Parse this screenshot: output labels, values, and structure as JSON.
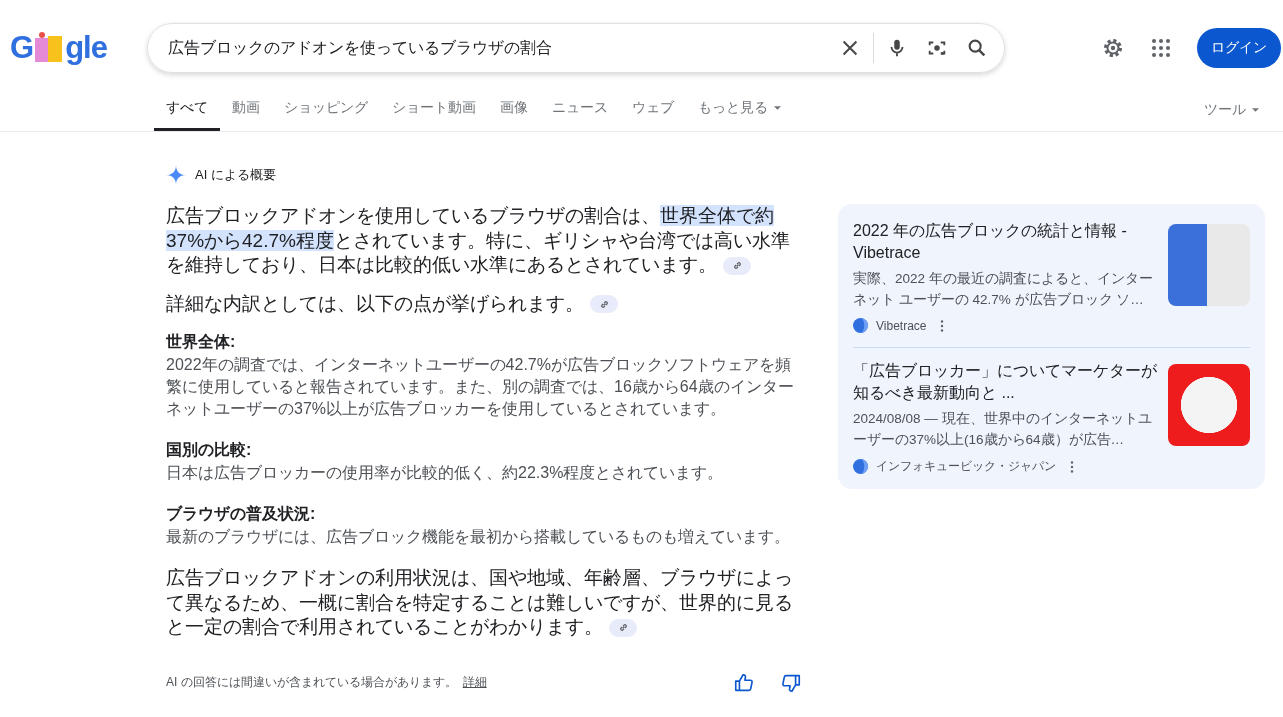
{
  "logo": {
    "left": "G",
    "right": "gle"
  },
  "search": {
    "value": "広告ブロックのアドオンを使っているブラウザの割合"
  },
  "header": {
    "login_button": "ログイン"
  },
  "tabs": [
    {
      "label": "すべて",
      "selected": true,
      "dropdown": false
    },
    {
      "label": "動画",
      "selected": false,
      "dropdown": false
    },
    {
      "label": "ショッピング",
      "selected": false,
      "dropdown": false
    },
    {
      "label": "ショート動画",
      "selected": false,
      "dropdown": false
    },
    {
      "label": "画像",
      "selected": false,
      "dropdown": false
    },
    {
      "label": "ニュース",
      "selected": false,
      "dropdown": false
    },
    {
      "label": "ウェブ",
      "selected": false,
      "dropdown": false
    },
    {
      "label": "もっと見る",
      "selected": false,
      "dropdown": true
    }
  ],
  "tools": "ツール",
  "overview": {
    "label": "AI による概要",
    "blocks": [
      {
        "kind": "paragraph",
        "source_link": true,
        "parts": [
          {
            "text": "広告ブロックアドオンを使用しているブラウザの割合は、",
            "highlighted": false
          },
          {
            "text": "世界全体で約37%から42.7%程度",
            "highlighted": true
          },
          {
            "text": "とされています。特に、ギリシャや台湾では高い水準を維持しており、日本は比較的低い水準にあるとされています。",
            "highlighted": false
          }
        ]
      },
      {
        "kind": "paragraph",
        "source_link": true,
        "parts": [
          {
            "text": "詳細な内訳としては、以下の点が挙げられます。",
            "highlighted": false
          }
        ]
      },
      {
        "kind": "section",
        "heading": "世界全体:",
        "body": "2022年の調査では、インターネットユーザーの42.7%が広告ブロックソフトウェアを頻繁に使用していると報告されています。また、別の調査では、16歳から64歳のインターネットユーザーの37%以上が広告ブロッカーを使用しているとされています。"
      },
      {
        "kind": "section",
        "heading": "国別の比較:",
        "body": "日本は広告ブロッカーの使用率が比較的低く、約22.3%程度とされています。"
      },
      {
        "kind": "section",
        "heading": "ブラウザの普及状況:",
        "body": "最新のブラウザには、広告ブロック機能を最初から搭載しているものも増えています。"
      },
      {
        "kind": "paragraph",
        "source_link": true,
        "parts": [
          {
            "text": "広告ブロックアドオンの利用状況は、国や地域、年齢層、ブラウザによって異なるため、一概に割合を特定することは難しいですが、世界的に見ると一定の割合で利用されていることがわかります。",
            "highlighted": false
          }
        ]
      }
    ],
    "disclaimer": "AI の回答には間違いが含まれている場合があります。",
    "details_link": "詳細"
  },
  "sources": [
    {
      "title": "2022 年の広告ブロックの統計と情報 - Vibetrace",
      "snippet": "実際、2022 年の最近の調査によると、インターネット ユーザーの 42.7% が広告ブロック ソ…",
      "site": "Vibetrace"
    },
    {
      "title": "「広告ブロッカー」についてマーケターが知るべき最新動向と ...",
      "snippet": "2024/08/08 — 現在、世界中のインターネットユーザーの37%以上(16歳から64歳）が広告…",
      "site": "インフォキュービック・ジャパン"
    }
  ]
}
